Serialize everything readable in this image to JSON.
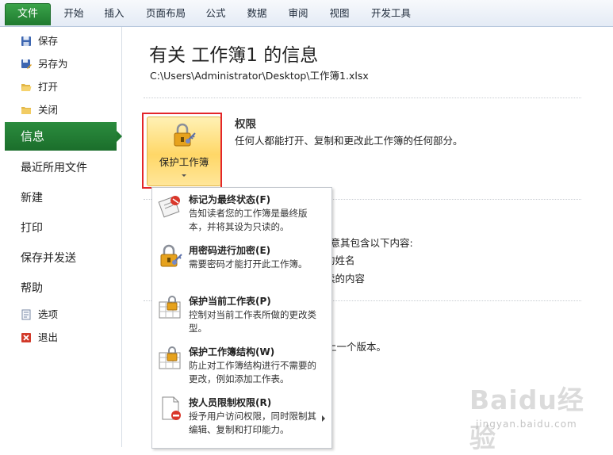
{
  "ribbon": {
    "tabs": [
      {
        "label": "文件",
        "selected": true
      },
      {
        "label": "开始"
      },
      {
        "label": "插入"
      },
      {
        "label": "页面布局"
      },
      {
        "label": "公式"
      },
      {
        "label": "数据"
      },
      {
        "label": "审阅"
      },
      {
        "label": "视图"
      },
      {
        "label": "开发工具"
      }
    ]
  },
  "nav": {
    "small_top": [
      {
        "label": "保存",
        "icon": "save-icon"
      },
      {
        "label": "另存为",
        "icon": "save-as-icon"
      },
      {
        "label": "打开",
        "icon": "open-folder-icon"
      },
      {
        "label": "关闭",
        "icon": "close-folder-icon"
      }
    ],
    "selected": "信息",
    "big": [
      "最近所用文件",
      "新建",
      "打印",
      "保存并发送",
      "帮助"
    ],
    "small_bottom": [
      {
        "label": "选项",
        "icon": "options-icon"
      },
      {
        "label": "退出",
        "icon": "exit-icon"
      }
    ]
  },
  "main": {
    "title": "有关 工作簿1 的信息",
    "path": "C:\\Users\\Administrator\\Desktop\\工作簿1.xlsx",
    "protect_button": {
      "label": "保护工作簿",
      "icon": "lock-keys-icon"
    },
    "permissions": {
      "heading": "权限",
      "description": "任何人都能打开、复制和更改此工作簿的任何部分。"
    },
    "partial_text": {
      "line1": "注意其包含以下内容:",
      "line2": "的姓名",
      "line3": "读的内容",
      "line4": "上一个版本。"
    }
  },
  "menu": {
    "items": [
      {
        "title": "标记为最终状态(F)",
        "desc": "告知读者您的工作簿是最终版本，并将其设为只读的。",
        "icon": "mark-final-icon"
      },
      {
        "title": "用密码进行加密(E)",
        "desc": "需要密码才能打开此工作簿。",
        "icon": "encrypt-lock-icon"
      },
      {
        "title": "保护当前工作表(P)",
        "desc": "控制对当前工作表所做的更改类型。",
        "icon": "protect-sheet-icon"
      },
      {
        "title": "保护工作簿结构(W)",
        "desc": "防止对工作簿结构进行不需要的更改，例如添加工作表。",
        "icon": "protect-structure-icon"
      },
      {
        "title": "按人员限制权限(R)",
        "desc": "授予用户访问权限，同时限制其编辑、复制和打印能力。",
        "icon": "restrict-permission-icon"
      }
    ]
  },
  "watermark": {
    "text": "Baidu经验",
    "sub": "jingyan.baidu.com"
  }
}
